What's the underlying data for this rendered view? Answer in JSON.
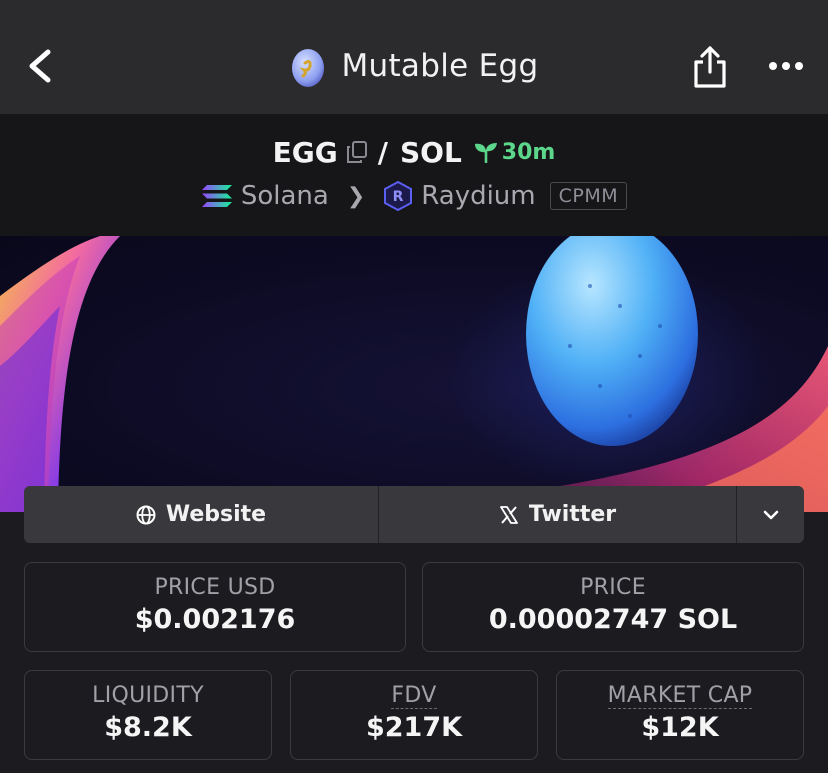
{
  "header": {
    "title": "Mutable Egg",
    "back_icon": "chevron-left-icon",
    "share_icon": "share-icon",
    "more_icon": "more-horizontal-icon"
  },
  "pair": {
    "base": "EGG",
    "separator": "/",
    "quote": "SOL",
    "age": "30m",
    "age_color": "#5cd68a"
  },
  "chain": {
    "network": "Solana",
    "dex": "Raydium",
    "pool_type": "CPMM"
  },
  "links": {
    "website": "Website",
    "twitter": "Twitter"
  },
  "stats": {
    "price_usd": {
      "label": "PRICE USD",
      "value": "$0.002176"
    },
    "price": {
      "label": "PRICE",
      "value": "0.00002747 SOL"
    },
    "liquidity": {
      "label": "LIQUIDITY",
      "value": "$8.2K"
    },
    "fdv": {
      "label": "FDV",
      "value": "$217K"
    },
    "market_cap": {
      "label": "MARKET CAP",
      "value": "$12K"
    }
  },
  "colors": {
    "header_bg": "#2b2b2e",
    "pair_bg": "#161619",
    "page_bg": "#1c1c20",
    "accent_green": "#5cd68a"
  }
}
